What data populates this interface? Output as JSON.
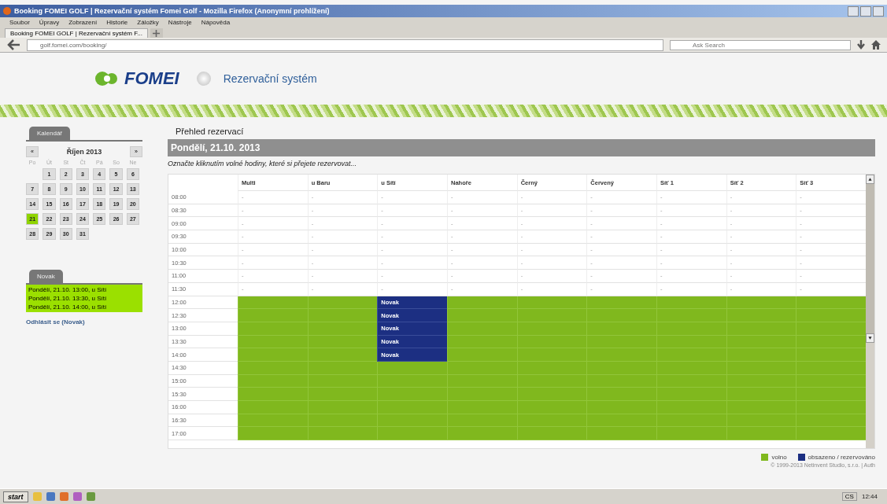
{
  "window": {
    "title": "Booking FOMEI GOLF | Rezervační systém Fomei Golf - Mozilla Firefox (Anonymní prohlížení)"
  },
  "menu": [
    "Soubor",
    "Úpravy",
    "Zobrazení",
    "Historie",
    "Záložky",
    "Nástroje",
    "Nápověda"
  ],
  "tabs": [
    {
      "label": "Booking FOMEI GOLF | Rezervační systém F...",
      "selected": true
    }
  ],
  "address_bar": {
    "url": "golf.fomei.com/booking/"
  },
  "search": {
    "placeholder": "Ask Search"
  },
  "header": {
    "logo": "FOMEI",
    "subtitle": "Rezervační systém"
  },
  "calendar": {
    "tab": "Kalendář",
    "month": "Říjen 2013",
    "prev": "«",
    "next": "»",
    "weekdays": [
      "Po",
      "Út",
      "St",
      "Čt",
      "Pá",
      "So",
      "Ne"
    ],
    "days": [
      {
        "d": "1",
        "selected": false
      },
      {
        "d": "2",
        "selected": false
      },
      {
        "d": "3",
        "selected": false
      },
      {
        "d": "4",
        "selected": false
      },
      {
        "d": "5",
        "selected": false
      },
      {
        "d": "6",
        "selected": false
      },
      {
        "d": "7",
        "selected": false
      },
      {
        "d": "8",
        "selected": false
      },
      {
        "d": "9",
        "selected": false
      },
      {
        "d": "10",
        "selected": false
      },
      {
        "d": "11",
        "selected": false
      },
      {
        "d": "12",
        "selected": false
      },
      {
        "d": "13",
        "selected": false
      },
      {
        "d": "14",
        "selected": false
      },
      {
        "d": "15",
        "selected": false
      },
      {
        "d": "16",
        "selected": false
      },
      {
        "d": "17",
        "selected": false
      },
      {
        "d": "18",
        "selected": false
      },
      {
        "d": "19",
        "selected": false
      },
      {
        "d": "20",
        "selected": false
      },
      {
        "d": "21",
        "selected": true
      },
      {
        "d": "22",
        "selected": false
      },
      {
        "d": "23",
        "selected": false
      },
      {
        "d": "24",
        "selected": false
      },
      {
        "d": "25",
        "selected": false
      },
      {
        "d": "26",
        "selected": false
      },
      {
        "d": "27",
        "selected": false
      },
      {
        "d": "28",
        "selected": false
      },
      {
        "d": "29",
        "selected": false
      },
      {
        "d": "30",
        "selected": false
      },
      {
        "d": "31",
        "selected": false
      }
    ]
  },
  "user_panel": {
    "tab": "Novak",
    "reservations": [
      "Pondělí, 21.10. 13:00, u Sítí",
      "Pondělí, 21.10. 13:30, u Sítí",
      "Pondělí, 21.10. 14:00, u Sítí"
    ],
    "logout": "Odhlásit se (Novak)"
  },
  "main": {
    "heading": "Přehled rezervací",
    "date": "Pondělí, 21.10. 2013",
    "hint": "Označte kliknutím volné hodiny, které si přejete rezervovat..."
  },
  "table": {
    "columns": [
      "Multi",
      "u Baru",
      "u Sítí",
      "Nahoře",
      "Černý",
      "Červený",
      "Síť 1",
      "Síť 2",
      "Síť 3"
    ],
    "rows": [
      {
        "time": "08:00",
        "cells": [
          {
            "kind": "past",
            "text": "-"
          },
          {
            "kind": "past",
            "text": "-"
          },
          {
            "kind": "past",
            "text": "-"
          },
          {
            "kind": "past",
            "text": "-"
          },
          {
            "kind": "past",
            "text": "-"
          },
          {
            "kind": "past",
            "text": "-"
          },
          {
            "kind": "past",
            "text": "-"
          },
          {
            "kind": "past",
            "text": "-"
          },
          {
            "kind": "past",
            "text": "-"
          }
        ]
      },
      {
        "time": "08:30",
        "cells": [
          {
            "kind": "past",
            "text": "-"
          },
          {
            "kind": "past",
            "text": "-"
          },
          {
            "kind": "past",
            "text": "-"
          },
          {
            "kind": "past",
            "text": "-"
          },
          {
            "kind": "past",
            "text": "-"
          },
          {
            "kind": "past",
            "text": "-"
          },
          {
            "kind": "past",
            "text": "-"
          },
          {
            "kind": "past",
            "text": "-"
          },
          {
            "kind": "past",
            "text": "-"
          }
        ]
      },
      {
        "time": "09:00",
        "cells": [
          {
            "kind": "past",
            "text": "-"
          },
          {
            "kind": "past",
            "text": "-"
          },
          {
            "kind": "past",
            "text": "-"
          },
          {
            "kind": "past",
            "text": "-"
          },
          {
            "kind": "past",
            "text": "-"
          },
          {
            "kind": "past",
            "text": "-"
          },
          {
            "kind": "past",
            "text": "-"
          },
          {
            "kind": "past",
            "text": "-"
          },
          {
            "kind": "past",
            "text": "-"
          }
        ]
      },
      {
        "time": "09:30",
        "cells": [
          {
            "kind": "past",
            "text": "-"
          },
          {
            "kind": "past",
            "text": "-"
          },
          {
            "kind": "past",
            "text": "-"
          },
          {
            "kind": "past",
            "text": "-"
          },
          {
            "kind": "past",
            "text": "-"
          },
          {
            "kind": "past",
            "text": "-"
          },
          {
            "kind": "past",
            "text": "-"
          },
          {
            "kind": "past",
            "text": "-"
          },
          {
            "kind": "past",
            "text": "-"
          }
        ]
      },
      {
        "time": "10:00",
        "cells": [
          {
            "kind": "past",
            "text": "-"
          },
          {
            "kind": "past",
            "text": "-"
          },
          {
            "kind": "past",
            "text": "-"
          },
          {
            "kind": "past",
            "text": "-"
          },
          {
            "kind": "past",
            "text": "-"
          },
          {
            "kind": "past",
            "text": "-"
          },
          {
            "kind": "past",
            "text": "-"
          },
          {
            "kind": "past",
            "text": "-"
          },
          {
            "kind": "past",
            "text": "-"
          }
        ]
      },
      {
        "time": "10:30",
        "cells": [
          {
            "kind": "past",
            "text": "-"
          },
          {
            "kind": "past",
            "text": "-"
          },
          {
            "kind": "past",
            "text": "-"
          },
          {
            "kind": "past",
            "text": "-"
          },
          {
            "kind": "past",
            "text": "-"
          },
          {
            "kind": "past",
            "text": "-"
          },
          {
            "kind": "past",
            "text": "-"
          },
          {
            "kind": "past",
            "text": "-"
          },
          {
            "kind": "past",
            "text": "-"
          }
        ]
      },
      {
        "time": "11:00",
        "cells": [
          {
            "kind": "past",
            "text": "-"
          },
          {
            "kind": "past",
            "text": "-"
          },
          {
            "kind": "past",
            "text": "-"
          },
          {
            "kind": "past",
            "text": "-"
          },
          {
            "kind": "past",
            "text": "-"
          },
          {
            "kind": "past",
            "text": "-"
          },
          {
            "kind": "past",
            "text": "-"
          },
          {
            "kind": "past",
            "text": "-"
          },
          {
            "kind": "past",
            "text": "-"
          }
        ]
      },
      {
        "time": "11:30",
        "cells": [
          {
            "kind": "past",
            "text": "-"
          },
          {
            "kind": "past",
            "text": "-"
          },
          {
            "kind": "past",
            "text": "-"
          },
          {
            "kind": "past",
            "text": "-"
          },
          {
            "kind": "past",
            "text": "-"
          },
          {
            "kind": "past",
            "text": "-"
          },
          {
            "kind": "past",
            "text": "-"
          },
          {
            "kind": "past",
            "text": "-"
          },
          {
            "kind": "past",
            "text": "-"
          }
        ]
      },
      {
        "time": "12:00",
        "cells": [
          {
            "kind": "free"
          },
          {
            "kind": "free"
          },
          {
            "kind": "booked",
            "text": "Novak"
          },
          {
            "kind": "free"
          },
          {
            "kind": "free"
          },
          {
            "kind": "free"
          },
          {
            "kind": "free"
          },
          {
            "kind": "free"
          },
          {
            "kind": "free"
          }
        ]
      },
      {
        "time": "12:30",
        "cells": [
          {
            "kind": "free"
          },
          {
            "kind": "free"
          },
          {
            "kind": "booked",
            "text": "Novak"
          },
          {
            "kind": "free"
          },
          {
            "kind": "free"
          },
          {
            "kind": "free"
          },
          {
            "kind": "free"
          },
          {
            "kind": "free"
          },
          {
            "kind": "free"
          }
        ]
      },
      {
        "time": "13:00",
        "cells": [
          {
            "kind": "free"
          },
          {
            "kind": "free"
          },
          {
            "kind": "booked",
            "text": "Novak"
          },
          {
            "kind": "free"
          },
          {
            "kind": "free"
          },
          {
            "kind": "free"
          },
          {
            "kind": "free"
          },
          {
            "kind": "free"
          },
          {
            "kind": "free"
          }
        ]
      },
      {
        "time": "13:30",
        "cells": [
          {
            "kind": "free"
          },
          {
            "kind": "free"
          },
          {
            "kind": "booked",
            "text": "Novak"
          },
          {
            "kind": "free"
          },
          {
            "kind": "free"
          },
          {
            "kind": "free"
          },
          {
            "kind": "free"
          },
          {
            "kind": "free"
          },
          {
            "kind": "free"
          }
        ]
      },
      {
        "time": "14:00",
        "cells": [
          {
            "kind": "free"
          },
          {
            "kind": "free"
          },
          {
            "kind": "booked",
            "text": "Novak"
          },
          {
            "kind": "free"
          },
          {
            "kind": "free"
          },
          {
            "kind": "free"
          },
          {
            "kind": "free"
          },
          {
            "kind": "free"
          },
          {
            "kind": "free"
          }
        ]
      },
      {
        "time": "14:30",
        "cells": [
          {
            "kind": "free"
          },
          {
            "kind": "free"
          },
          {
            "kind": "free"
          },
          {
            "kind": "free"
          },
          {
            "kind": "free"
          },
          {
            "kind": "free"
          },
          {
            "kind": "free"
          },
          {
            "kind": "free"
          },
          {
            "kind": "free"
          }
        ]
      },
      {
        "time": "15:00",
        "cells": [
          {
            "kind": "free"
          },
          {
            "kind": "free"
          },
          {
            "kind": "free"
          },
          {
            "kind": "free"
          },
          {
            "kind": "free"
          },
          {
            "kind": "free"
          },
          {
            "kind": "free"
          },
          {
            "kind": "free"
          },
          {
            "kind": "free"
          }
        ]
      },
      {
        "time": "15:30",
        "cells": [
          {
            "kind": "free"
          },
          {
            "kind": "free"
          },
          {
            "kind": "free"
          },
          {
            "kind": "free"
          },
          {
            "kind": "free"
          },
          {
            "kind": "free"
          },
          {
            "kind": "free"
          },
          {
            "kind": "free"
          },
          {
            "kind": "free"
          }
        ]
      },
      {
        "time": "16:00",
        "cells": [
          {
            "kind": "free"
          },
          {
            "kind": "free"
          },
          {
            "kind": "free"
          },
          {
            "kind": "free"
          },
          {
            "kind": "free"
          },
          {
            "kind": "free"
          },
          {
            "kind": "free"
          },
          {
            "kind": "free"
          },
          {
            "kind": "free"
          }
        ]
      },
      {
        "time": "16:30",
        "cells": [
          {
            "kind": "free"
          },
          {
            "kind": "free"
          },
          {
            "kind": "free"
          },
          {
            "kind": "free"
          },
          {
            "kind": "free"
          },
          {
            "kind": "free"
          },
          {
            "kind": "free"
          },
          {
            "kind": "free"
          },
          {
            "kind": "free"
          }
        ]
      },
      {
        "time": "17:00",
        "cells": [
          {
            "kind": "free"
          },
          {
            "kind": "free"
          },
          {
            "kind": "free"
          },
          {
            "kind": "free"
          },
          {
            "kind": "free"
          },
          {
            "kind": "free"
          },
          {
            "kind": "free"
          },
          {
            "kind": "free"
          },
          {
            "kind": "free"
          }
        ]
      }
    ]
  },
  "legend": [
    {
      "label": "volno",
      "color": "#80b81e"
    },
    {
      "label": "obsazeno / rezervováno",
      "color": "#1c2f82"
    }
  ],
  "footer": "© 1999-2013 Netinvent Studio, s.r.o. | Auth",
  "taskbar": {
    "start": "start",
    "language": "CS",
    "clock": "12:44"
  }
}
